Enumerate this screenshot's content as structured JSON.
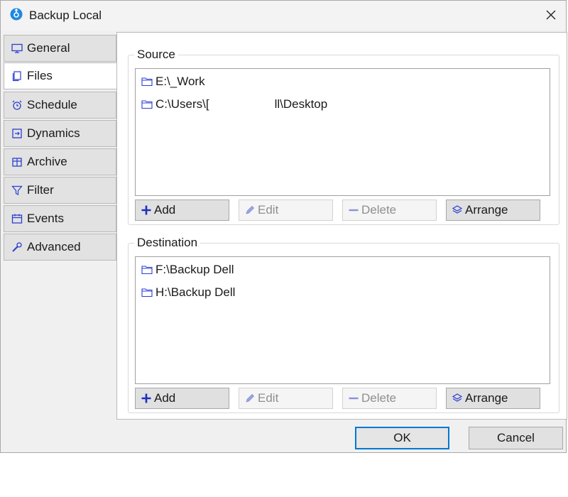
{
  "window": {
    "title": "Backup Local",
    "close_glyph": "✕"
  },
  "tabs": [
    {
      "label": "General",
      "icon": "monitor-icon",
      "active": false
    },
    {
      "label": "Files",
      "icon": "document-icon",
      "active": true
    },
    {
      "label": "Schedule",
      "icon": "alarm-clock-icon",
      "active": false
    },
    {
      "label": "Dynamics",
      "icon": "dynamics-icon",
      "active": false
    },
    {
      "label": "Archive",
      "icon": "archive-box-icon",
      "active": false
    },
    {
      "label": "Filter",
      "icon": "funnel-icon",
      "active": false
    },
    {
      "label": "Events",
      "icon": "calendar-icon",
      "active": false
    },
    {
      "label": "Advanced",
      "icon": "wrench-icon",
      "active": false
    }
  ],
  "source": {
    "title": "Source",
    "items": [
      "E:\\_Work",
      "C:\\Users\\[",
      "ll\\Desktop"
    ],
    "buttons": {
      "add": "Add",
      "edit": "Edit",
      "delete": "Delete",
      "arrange": "Arrange"
    }
  },
  "destination": {
    "title": "Destination",
    "items": [
      "F:\\Backup Dell",
      "H:\\Backup Dell"
    ],
    "buttons": {
      "add": "Add",
      "edit": "Edit",
      "delete": "Delete",
      "arrange": "Arrange"
    }
  },
  "dialog": {
    "ok_label": "OK",
    "cancel_label": "Cancel"
  },
  "colors": {
    "accent": "#0078d4",
    "icon_blue": "#2a3fd1"
  }
}
